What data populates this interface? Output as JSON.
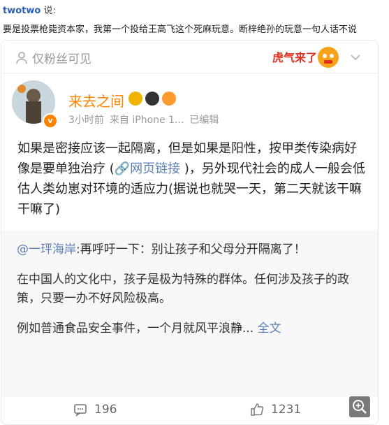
{
  "top_comment": {
    "username": "twotwo",
    "said": "说:",
    "text": "要是投票枪毙资本家，我第一个投给王高飞这个死麻玩意。断梓绝孙的玩意一句人话不说"
  },
  "card": {
    "visibility_label": "仅粉丝可见",
    "sticker_text": "虎气来了",
    "author": {
      "name": "来去之间",
      "time": "3小时前",
      "source": "来自 iPhone 1...",
      "edited": "已编辑"
    },
    "post": {
      "text_before": "如果是密接应该一起隔离，但是如果是阳性，按甲类传染病好像是要单独治疗 (",
      "link_label": "网页链接",
      "text_after": " )，另外现代社会的成人一般会低估人类幼崽对环境的适应力(据说也就哭一天，第二天就该干嘛干嘛了)"
    },
    "repost": {
      "mention": "@一玶海岸",
      "mention_text": ":再呼吁一下：别让孩子和父母分开隔离了！",
      "para2": "在中国人的文化中，孩子是极为特殊的群体。任何涉及孩子的政策，只要一办不好风险极高。",
      "para3": "例如普通食品安全事件，一个月就风平浪静...",
      "full_label": "全文"
    },
    "footer": {
      "comments": "196",
      "likes": "1231"
    }
  },
  "colors": {
    "accent": "#ff8200",
    "link": "#5b7fb5",
    "username": "#2a5fb6"
  }
}
